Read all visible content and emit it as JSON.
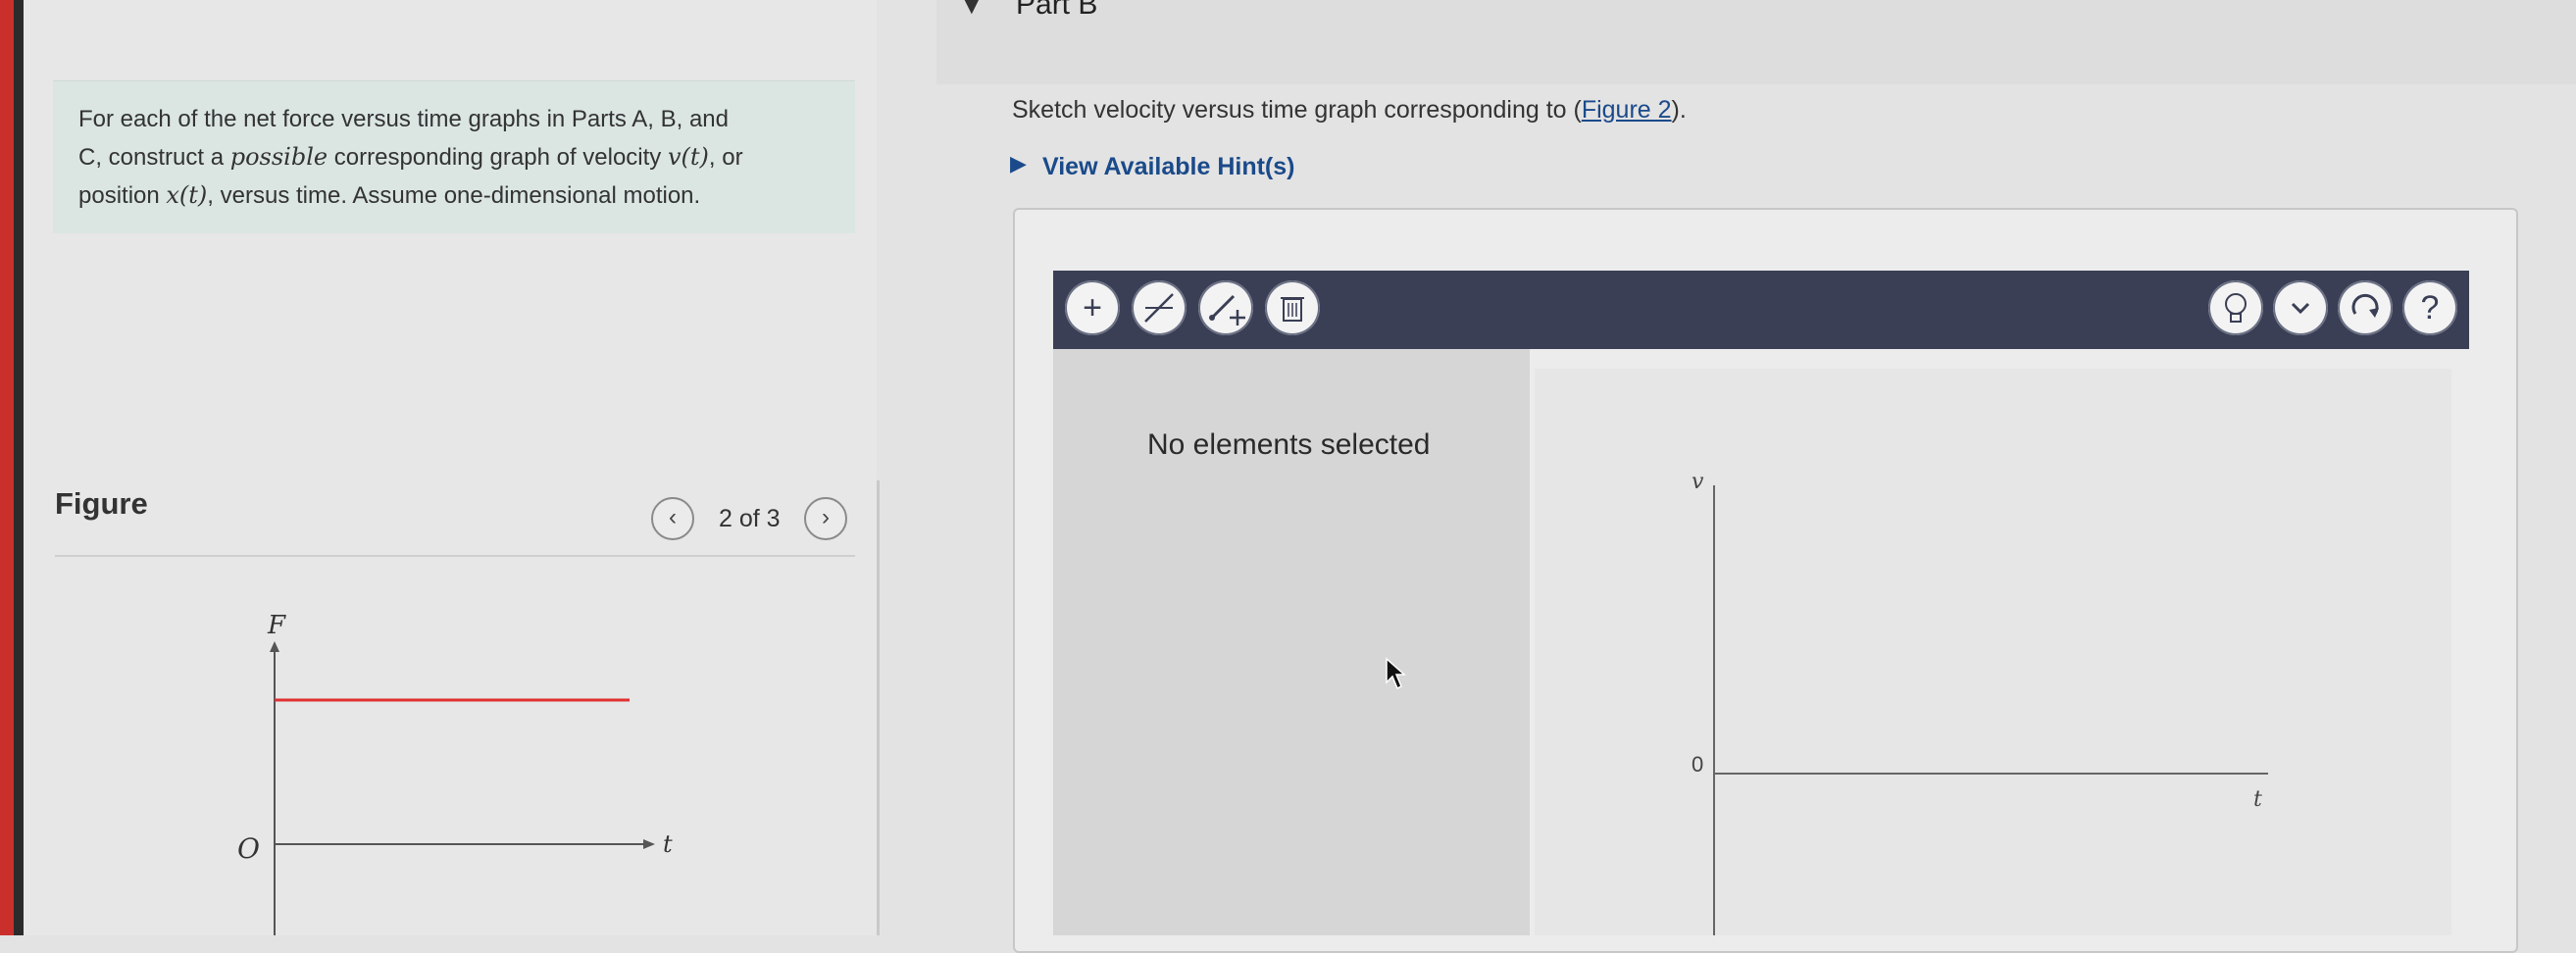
{
  "intro": {
    "line1": "For each of the net force versus time graphs in Parts A, B, and",
    "line2_a": "C, construct a ",
    "line2_em": "possible",
    "line2_b": " corresponding graph of velocity ",
    "line2_math": "v(t)",
    "line2_c": ", or",
    "line3_a": "position ",
    "line3_math": "x(t)",
    "line3_b": ", versus time. Assume one-dimensional motion."
  },
  "figure": {
    "title": "Figure",
    "pager": "2 of 3",
    "prev_icon": "chevron-left-icon",
    "next_icon": "chevron-right-icon",
    "graph": {
      "y_label": "F",
      "x_label": "t",
      "origin_label": "O",
      "line_color": "#e03030"
    }
  },
  "part": {
    "title": "Part B",
    "prompt_a": "Sketch velocity versus time graph corresponding to (",
    "prompt_link": "Figure 2",
    "prompt_b": ").",
    "hint": "View Available Hint(s)"
  },
  "tool": {
    "toolbar_left": [
      {
        "icon": "plus-icon",
        "glyph": "+"
      },
      {
        "icon": "line-tool-icon",
        "glyph": "/"
      },
      {
        "icon": "add-point-icon",
        "glyph": "+"
      },
      {
        "icon": "trash-icon",
        "glyph": "🗑"
      }
    ],
    "toolbar_right": [
      {
        "icon": "lightbulb-icon",
        "glyph": "💡"
      },
      {
        "icon": "chevron-down-icon",
        "glyph": "⌄"
      },
      {
        "icon": "reset-icon",
        "glyph": "↻"
      },
      {
        "icon": "help-icon",
        "glyph": "?"
      }
    ],
    "selection_status": "No elements selected",
    "graph": {
      "y_label": "v",
      "x_label": "t",
      "zero_label": "0"
    }
  },
  "colors": {
    "accent": "#1a4a8a",
    "toolbar": "#3a3f55",
    "intro_bg": "#dbe6e3",
    "force_line": "#e03030"
  }
}
